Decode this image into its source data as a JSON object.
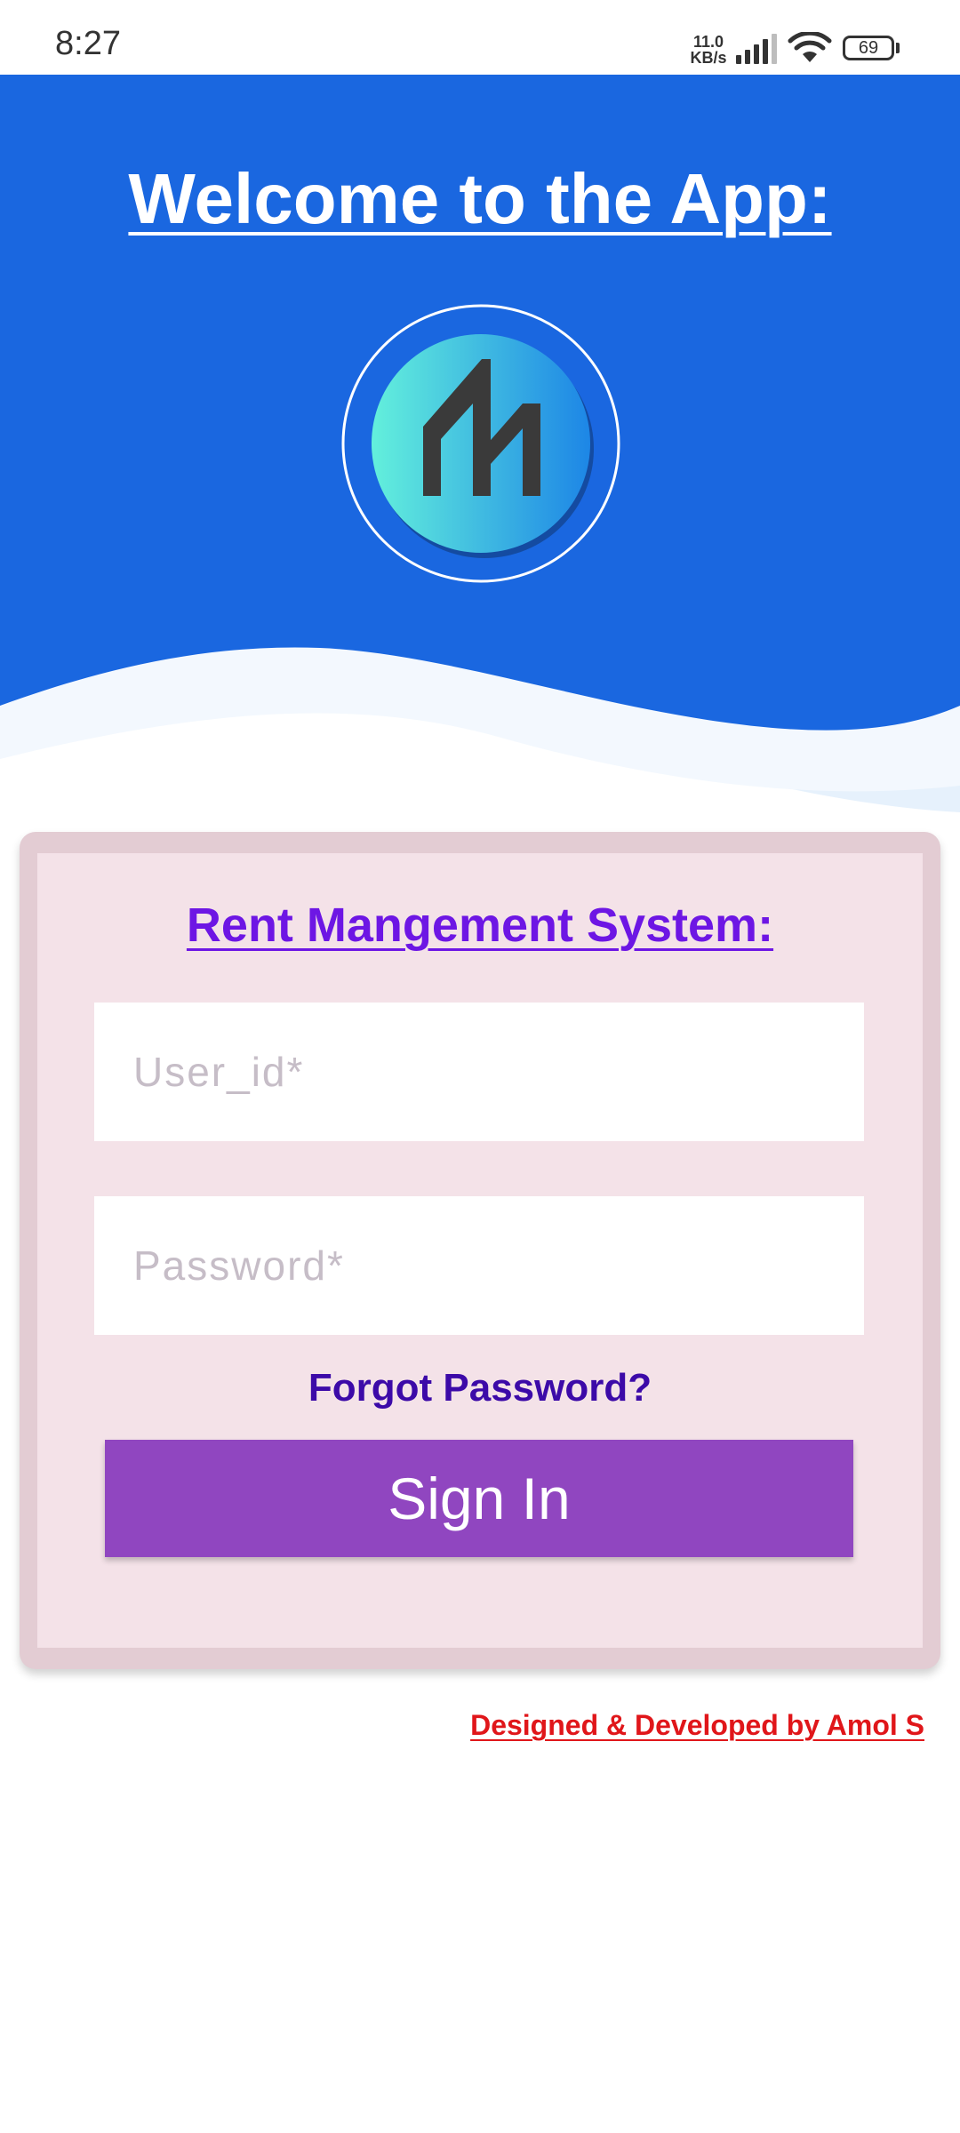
{
  "status_bar": {
    "time": "8:27",
    "net_speed_value": "11.0",
    "net_speed_unit": "KB/s",
    "battery_level": "69",
    "signal_icon": "cellular-signal-icon",
    "wifi_icon": "wifi-icon"
  },
  "header": {
    "title": "Welcome to the App:",
    "logo_icon": "app-logo-icon",
    "background_color": "#1a67e0"
  },
  "login": {
    "title": "Rent Mangement System:",
    "user_placeholder": "User_id*",
    "user_value": "",
    "password_placeholder": "Password*",
    "password_value": "",
    "forgot_label": "Forgot Password?",
    "signin_label": "Sign In",
    "button_color": "#9046c0",
    "card_color": "#f4e2e8"
  },
  "footer": {
    "credits": "Designed & Developed by Amol S",
    "credits_color": "#e0161a"
  }
}
